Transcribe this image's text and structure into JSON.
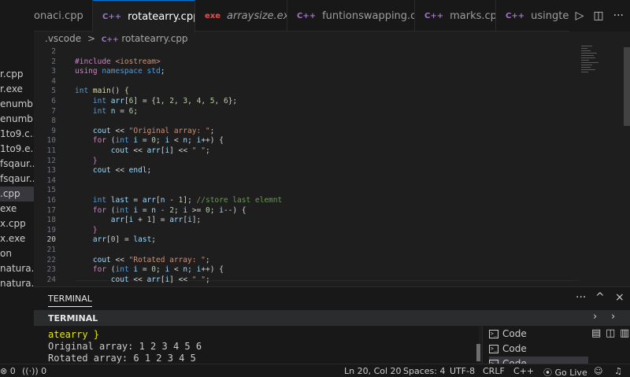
{
  "sidebar": {
    "items": [
      {
        "label": "r.cpp"
      },
      {
        "label": "r.exe"
      },
      {
        "label": "enumb..."
      },
      {
        "label": "enumb..."
      },
      {
        "label": "1to9.c..."
      },
      {
        "label": "1to9.e..."
      },
      {
        "label": "fsqaur..."
      },
      {
        "label": "fsqaur..."
      },
      {
        "label": ".cpp"
      },
      {
        "label": "exe"
      },
      {
        "label": "x.cpp"
      },
      {
        "label": "x.exe"
      },
      {
        "label": "on"
      },
      {
        "label": "natura..."
      },
      {
        "label": "natura..."
      }
    ],
    "selected_index": 8
  },
  "tabs": [
    {
      "icon": "C++",
      "label": "onaci.cpp",
      "active": false
    },
    {
      "icon": "C++",
      "label": "rotatearry.cpp",
      "active": true,
      "close": "×"
    },
    {
      "icon": "exe",
      "label": "arraysize.exe",
      "active": false
    },
    {
      "icon": "C++",
      "label": "funtionswapping.cpp",
      "active": false
    },
    {
      "icon": "C++",
      "label": "marks.cpp",
      "active": false
    },
    {
      "icon": "C++",
      "label": "usingternary",
      "active": false
    }
  ],
  "breadcrumb": {
    "folder": ".vscode",
    "separator": ">",
    "file_icon": "C++",
    "file": "rotatearry.cpp"
  },
  "editor": {
    "current_line": 20,
    "lines": [
      {
        "n": "2",
        "tokens": [
          {
            "t": "",
            "c": ""
          }
        ]
      },
      {
        "n": "2",
        "tokens": [
          {
            "t": "#include ",
            "c": "pp"
          },
          {
            "t": "<iostream>",
            "c": "str"
          }
        ]
      },
      {
        "n": "3",
        "tokens": [
          {
            "t": "using ",
            "c": "pp"
          },
          {
            "t": "namespace ",
            "c": "kw"
          },
          {
            "t": "std",
            "c": "ty"
          },
          {
            "t": ";",
            "c": ""
          }
        ]
      },
      {
        "n": "4",
        "tokens": []
      },
      {
        "n": "5",
        "tokens": [
          {
            "t": "int ",
            "c": "kw"
          },
          {
            "t": "main",
            "c": "fn"
          },
          {
            "t": "() ",
            "c": ""
          },
          {
            "t": "{",
            "c": "fn"
          }
        ]
      },
      {
        "n": "6",
        "tokens": [
          {
            "t": "    int ",
            "c": "kw"
          },
          {
            "t": "arr",
            "c": "var"
          },
          {
            "t": "[",
            "c": ""
          },
          {
            "t": "6",
            "c": "num"
          },
          {
            "t": "] = {",
            "c": ""
          },
          {
            "t": "1",
            "c": "num"
          },
          {
            "t": ", ",
            "c": ""
          },
          {
            "t": "2",
            "c": "num"
          },
          {
            "t": ", ",
            "c": ""
          },
          {
            "t": "3",
            "c": "num"
          },
          {
            "t": ", ",
            "c": ""
          },
          {
            "t": "4",
            "c": "num"
          },
          {
            "t": ", ",
            "c": ""
          },
          {
            "t": "5",
            "c": "num"
          },
          {
            "t": ", ",
            "c": ""
          },
          {
            "t": "6",
            "c": "num"
          },
          {
            "t": "};",
            "c": ""
          }
        ]
      },
      {
        "n": "7",
        "tokens": [
          {
            "t": "    int ",
            "c": "kw"
          },
          {
            "t": "n",
            "c": "var"
          },
          {
            "t": " = ",
            "c": ""
          },
          {
            "t": "6",
            "c": "num"
          },
          {
            "t": ";",
            "c": ""
          }
        ]
      },
      {
        "n": "8",
        "tokens": []
      },
      {
        "n": "9",
        "tokens": [
          {
            "t": "    cout",
            "c": "var"
          },
          {
            "t": " << ",
            "c": ""
          },
          {
            "t": "\"Original array: \"",
            "c": "str"
          },
          {
            "t": ";",
            "c": ""
          }
        ]
      },
      {
        "n": "10",
        "tokens": [
          {
            "t": "    for",
            "c": "pp"
          },
          {
            "t": " (",
            "c": ""
          },
          {
            "t": "int ",
            "c": "kw"
          },
          {
            "t": "i",
            "c": "var"
          },
          {
            "t": " = ",
            "c": ""
          },
          {
            "t": "0",
            "c": "num"
          },
          {
            "t": "; ",
            "c": ""
          },
          {
            "t": "i",
            "c": "var"
          },
          {
            "t": " < ",
            "c": ""
          },
          {
            "t": "n",
            "c": "var"
          },
          {
            "t": "; ",
            "c": ""
          },
          {
            "t": "i",
            "c": "var"
          },
          {
            "t": "++) {",
            "c": ""
          }
        ]
      },
      {
        "n": "11",
        "tokens": [
          {
            "t": "        cout",
            "c": "var"
          },
          {
            "t": " << ",
            "c": ""
          },
          {
            "t": "arr",
            "c": "var"
          },
          {
            "t": "[",
            "c": ""
          },
          {
            "t": "i",
            "c": "var"
          },
          {
            "t": "] << ",
            "c": ""
          },
          {
            "t": "\" \"",
            "c": "str"
          },
          {
            "t": ";",
            "c": ""
          }
        ]
      },
      {
        "n": "12",
        "tokens": [
          {
            "t": "    }",
            "c": "pp"
          }
        ]
      },
      {
        "n": "13",
        "tokens": [
          {
            "t": "    cout",
            "c": "var"
          },
          {
            "t": " << ",
            "c": ""
          },
          {
            "t": "endl",
            "c": "var"
          },
          {
            "t": ";",
            "c": ""
          }
        ]
      },
      {
        "n": "14",
        "tokens": []
      },
      {
        "n": "15",
        "tokens": []
      },
      {
        "n": "16",
        "tokens": [
          {
            "t": "    int ",
            "c": "kw"
          },
          {
            "t": "last",
            "c": "var"
          },
          {
            "t": " = ",
            "c": ""
          },
          {
            "t": "arr",
            "c": "var"
          },
          {
            "t": "[",
            "c": ""
          },
          {
            "t": "n",
            "c": "var"
          },
          {
            "t": " - ",
            "c": ""
          },
          {
            "t": "1",
            "c": "num"
          },
          {
            "t": "]; ",
            "c": ""
          },
          {
            "t": "//store last elemnt",
            "c": "cm"
          }
        ]
      },
      {
        "n": "17",
        "tokens": [
          {
            "t": "    for",
            "c": "pp"
          },
          {
            "t": " (",
            "c": ""
          },
          {
            "t": "int ",
            "c": "kw"
          },
          {
            "t": "i",
            "c": "var"
          },
          {
            "t": " = ",
            "c": ""
          },
          {
            "t": "n",
            "c": "var"
          },
          {
            "t": " - ",
            "c": ""
          },
          {
            "t": "2",
            "c": "num"
          },
          {
            "t": "; ",
            "c": ""
          },
          {
            "t": "i",
            "c": "var"
          },
          {
            "t": " >= ",
            "c": ""
          },
          {
            "t": "0",
            "c": "num"
          },
          {
            "t": "; ",
            "c": ""
          },
          {
            "t": "i",
            "c": "var"
          },
          {
            "t": "--) {",
            "c": ""
          }
        ]
      },
      {
        "n": "18",
        "tokens": [
          {
            "t": "        arr",
            "c": "var"
          },
          {
            "t": "[",
            "c": ""
          },
          {
            "t": "i",
            "c": "var"
          },
          {
            "t": " + ",
            "c": ""
          },
          {
            "t": "1",
            "c": "num"
          },
          {
            "t": "] = ",
            "c": ""
          },
          {
            "t": "arr",
            "c": "var"
          },
          {
            "t": "[",
            "c": ""
          },
          {
            "t": "i",
            "c": "var"
          },
          {
            "t": "];",
            "c": ""
          }
        ]
      },
      {
        "n": "19",
        "tokens": [
          {
            "t": "    }",
            "c": "pp"
          }
        ]
      },
      {
        "n": "20",
        "tokens": [
          {
            "t": "    arr",
            "c": "var"
          },
          {
            "t": "[",
            "c": ""
          },
          {
            "t": "0",
            "c": "num"
          },
          {
            "t": "] = ",
            "c": ""
          },
          {
            "t": "last",
            "c": "var"
          },
          {
            "t": ";",
            "c": ""
          }
        ]
      },
      {
        "n": "21",
        "tokens": []
      },
      {
        "n": "22",
        "tokens": [
          {
            "t": "    cout",
            "c": "var"
          },
          {
            "t": " << ",
            "c": ""
          },
          {
            "t": "\"Rotated array: \"",
            "c": "str"
          },
          {
            "t": ";",
            "c": ""
          }
        ]
      },
      {
        "n": "23",
        "tokens": [
          {
            "t": "    for",
            "c": "pp"
          },
          {
            "t": " (",
            "c": ""
          },
          {
            "t": "int ",
            "c": "kw"
          },
          {
            "t": "i",
            "c": "var"
          },
          {
            "t": " = ",
            "c": ""
          },
          {
            "t": "0",
            "c": "num"
          },
          {
            "t": "; ",
            "c": ""
          },
          {
            "t": "i",
            "c": "var"
          },
          {
            "t": " < ",
            "c": ""
          },
          {
            "t": "n",
            "c": "var"
          },
          {
            "t": "; ",
            "c": ""
          },
          {
            "t": "i",
            "c": "var"
          },
          {
            "t": "++) {",
            "c": ""
          }
        ]
      },
      {
        "n": "24",
        "tokens": [
          {
            "t": "        cout",
            "c": "var"
          },
          {
            "t": " << ",
            "c": ""
          },
          {
            "t": "arr",
            "c": "var"
          },
          {
            "t": "[",
            "c": ""
          },
          {
            "t": "i",
            "c": "var"
          },
          {
            "t": "] << ",
            "c": ""
          },
          {
            "t": "\" \"",
            "c": "str"
          },
          {
            "t": ";",
            "c": ""
          }
        ]
      }
    ]
  },
  "panel": {
    "tab_label": "TERMINAL",
    "more": "···",
    "up": "^",
    "close": "×",
    "section_label": "TERMINAL",
    "output": [
      "atearry }",
      "Original array: 1 2 3 4 5 6",
      "Rotated array: 6 1 2 3 4 5"
    ],
    "terminals": [
      {
        "label": "Code"
      },
      {
        "label": "Code"
      },
      {
        "label": "Code"
      }
    ],
    "terminal_icon": ">_"
  },
  "statusbar": {
    "errors": "0",
    "warnings": "0",
    "position": "Ln 20, Col 20",
    "spaces": "Spaces: 4",
    "encoding": "UTF-8",
    "eol": "CRLF",
    "language": "C++",
    "live": "Go Live"
  }
}
